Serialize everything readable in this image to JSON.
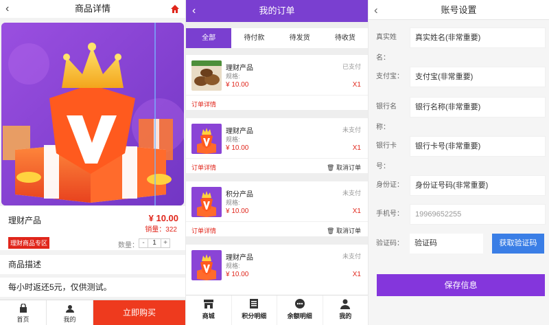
{
  "product_detail": {
    "title": "商品详情",
    "product_name": "理财产品",
    "price": "¥ 10.00",
    "sales": "销量：322",
    "zone_tag": "理财商品专区",
    "qty_label": "数量：",
    "qty_minus": "-",
    "qty_value": "1",
    "qty_plus": "+",
    "desc_title": "商品描述",
    "desc_text": "每小时返还5元，仅供测试。",
    "nav": {
      "home": "首页",
      "mine": "我的"
    },
    "buy_label": "立即购买"
  },
  "orders": {
    "title": "我的订单",
    "tabs": [
      "全部",
      "待付款",
      "待发货",
      "待收货"
    ],
    "spec_label": "规格:",
    "detail_label": "订单详情",
    "cancel_label": "取消订单",
    "items": [
      {
        "name": "理财产品",
        "status": "已支付",
        "price": "¥ 10.00",
        "count": "X1",
        "thumb": "food"
      },
      {
        "name": "理财产品",
        "status": "未支付",
        "price": "¥ 10.00",
        "count": "X1",
        "thumb": "gift"
      },
      {
        "name": "积分产品",
        "status": "未支付",
        "price": "¥ 10.00",
        "count": "X1",
        "thumb": "gift"
      },
      {
        "name": "理财产品",
        "status": "未支付",
        "price": "¥ 10.00",
        "count": "X1",
        "thumb": "gift"
      }
    ],
    "nav": [
      "商城",
      "积分明细",
      "余额明细",
      "我的"
    ]
  },
  "account": {
    "title": "账号设置",
    "fields": [
      {
        "label": "真实姓名：",
        "value": "真实姓名(非常重要)",
        "placeholder": false
      },
      {
        "label": "支付宝：",
        "value": "支付宝(非常重要)",
        "placeholder": false
      },
      {
        "label": "银行名称：",
        "value": "银行名称(非常重要)",
        "placeholder": false
      },
      {
        "label": "银行卡号：",
        "value": "银行卡号(非常重要)",
        "placeholder": false
      },
      {
        "label": "身份证：",
        "value": "身份证号码(非常重要)",
        "placeholder": false
      },
      {
        "label": "手机号：",
        "value": "19969652255",
        "placeholder": true
      }
    ],
    "code_label": "验证码：",
    "code_placeholder": "验证码",
    "get_code_label": "获取验证码",
    "save_label": "保存信息"
  },
  "colors": {
    "purple": "#7a3fd0",
    "red": "#e0261b",
    "buy": "#ee3a1e",
    "blue": "#3a7ee6"
  }
}
